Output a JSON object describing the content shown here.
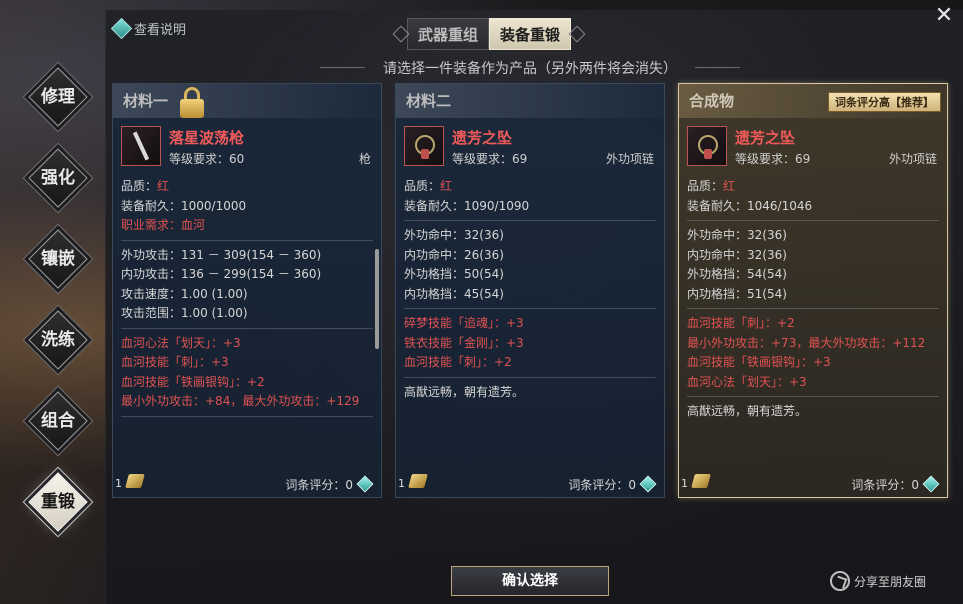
{
  "help": {
    "label": "查看说明"
  },
  "tabs": [
    {
      "label": "武器重组",
      "active": false
    },
    {
      "label": "装备重锻",
      "active": true
    }
  ],
  "subtitle": "请选择一件装备作为产品（另外两件将会消失）",
  "nav": [
    {
      "label": "修理",
      "active": false
    },
    {
      "label": "强化",
      "active": false
    },
    {
      "label": "镶嵌",
      "active": false
    },
    {
      "label": "洗练",
      "active": false
    },
    {
      "label": "组合",
      "active": false
    },
    {
      "label": "重锻",
      "active": true
    }
  ],
  "panels": [
    {
      "header": "材料一",
      "locked": true,
      "item": {
        "name": "落星波荡枪",
        "req": "等级要求：60",
        "type": "枪",
        "icon": "spear-icon"
      },
      "base": [
        {
          "label": "品质：",
          "value": "红",
          "value_red": true
        },
        {
          "label": "装备耐久：1000/1000"
        },
        {
          "label": "职业需求：血河",
          "red": true
        }
      ],
      "stats": [
        "外功攻击：131 － 309(154 － 360)",
        "内功攻击：136 － 299(154 － 360)",
        "攻击速度：1.00 (1.00)",
        "攻击范围：1.00 (1.00)"
      ],
      "affixes": [
        "血河心法「划天」：+3",
        "血河技能「刺」：+3",
        "血河技能「铁画银钩」：+2",
        "最小外功攻击：+84，最大外功攻击：+129"
      ],
      "desc": "",
      "count": "1",
      "score": "词条评分：0"
    },
    {
      "header": "材料二",
      "locked": false,
      "item": {
        "name": "遗芳之坠",
        "req": "等级要求：69",
        "type": "外功项链",
        "icon": "necklace-icon"
      },
      "base": [
        {
          "label": "品质：",
          "value": "红",
          "value_red": true
        },
        {
          "label": "装备耐久：1090/1090"
        }
      ],
      "stats": [
        "外功命中：32(36)",
        "内功命中：26(36)",
        "外功格挡：50(54)",
        "内功格挡：45(54)"
      ],
      "affixes": [
        "碎梦技能「追魂」：+3",
        "铁衣技能「金刚」：+3",
        "血河技能「刺」：+2"
      ],
      "desc": "高猷远畅，朝有遗芳。",
      "count": "1",
      "score": "词条评分：0"
    },
    {
      "header": "合成物",
      "locked": false,
      "badge": "词条评分高【推荐】",
      "item": {
        "name": "遗芳之坠",
        "req": "等级要求：69",
        "type": "外功项链",
        "icon": "necklace-icon"
      },
      "base": [
        {
          "label": "品质：",
          "value": "红",
          "value_red": true
        },
        {
          "label": "装备耐久：1046/1046"
        }
      ],
      "stats": [
        "外功命中：32(36)",
        "内功命中：32(36)",
        "外功格挡：54(54)",
        "内功格挡：51(54)"
      ],
      "affixes": [
        "血河技能「刺」：+2",
        "最小外功攻击：+73，最大外功攻击：+112",
        "血河技能「铁画银钩」：+3",
        "血河心法「划天」：+3"
      ],
      "desc": "高猷远畅，朝有遗芳。",
      "count": "1",
      "score": "词条评分：0"
    }
  ],
  "confirm": {
    "label": "确认选择"
  },
  "share": {
    "label": "分享至朋友圈"
  },
  "colors": {
    "red": "#e05252",
    "accent_gold": "#d8c8a0",
    "gem": "#5fd6cc"
  }
}
